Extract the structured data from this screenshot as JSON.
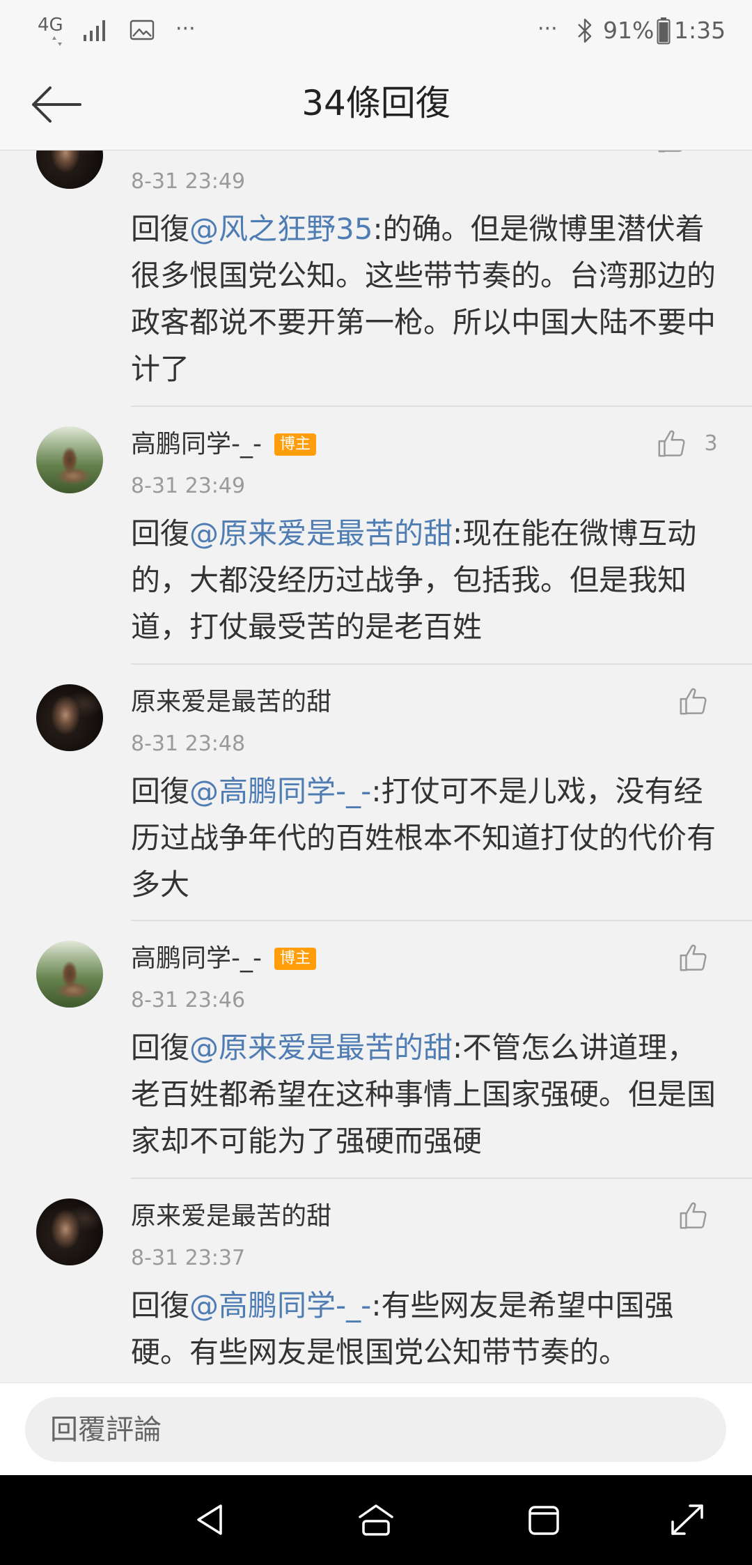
{
  "status_bar": {
    "network": "4G",
    "left_more": "···",
    "right_more": "···",
    "battery_level": "91%",
    "time": "1:35"
  },
  "header": {
    "title": "34條回復"
  },
  "comments": [
    {
      "time": "8-31 23:49",
      "reply_prefix": "回復",
      "mention": "@风之狂野35",
      "text": ":的确。但是微博里潜伏着很多恨国党公知。这些带节奏的。台湾那边的政客都说不要开第一枪。所以中国大陆不要中计了"
    },
    {
      "author": "高鹏同学-_-",
      "badge": "博主",
      "time": "8-31 23:49",
      "reply_prefix": "回復",
      "mention": "@原来爱是最苦的甜",
      "text": ":现在能在微博互动的，大都没经历过战争，包括我。但是我知道，打仗最受苦的是老百姓",
      "likes": "3"
    },
    {
      "author": "原来爱是最苦的甜",
      "time": "8-31 23:48",
      "reply_prefix": "回復",
      "mention": "@高鹏同学-_-",
      "text": ":打仗可不是儿戏，没有经历过战争年代的百姓根本不知道打仗的代价有多大"
    },
    {
      "author": "高鹏同学-_-",
      "badge": "博主",
      "time": "8-31 23:46",
      "reply_prefix": "回復",
      "mention": "@原来爱是最苦的甜",
      "text": ":不管怎么讲道理，老百姓都希望在这种事情上国家强硬。但是国家却不可能为了强硬而强硬"
    },
    {
      "author": "原来爱是最苦的甜",
      "time": "8-31 23:37",
      "reply_prefix": "回復",
      "mention": "@高鹏同学-_-",
      "text": ":有些网友是希望中国强硬。有些网友是恨国党公知带节奏的。"
    }
  ],
  "input": {
    "placeholder": "回覆評論"
  },
  "icons": {
    "status": [
      "network-4g-icon",
      "signal-icon",
      "image-icon",
      "bluetooth-icon",
      "battery-icon"
    ],
    "back": "arrow-left-icon",
    "like": "thumbs-up-icon",
    "nav": [
      "nav-back-icon",
      "nav-home-icon",
      "nav-recent-apps-icon",
      "nav-expand-icon"
    ]
  },
  "colors": {
    "mention": "#4f7db3",
    "badge": "#ff9d0a",
    "list_background": "#f2f2f2",
    "nav_bar": "#000000"
  }
}
